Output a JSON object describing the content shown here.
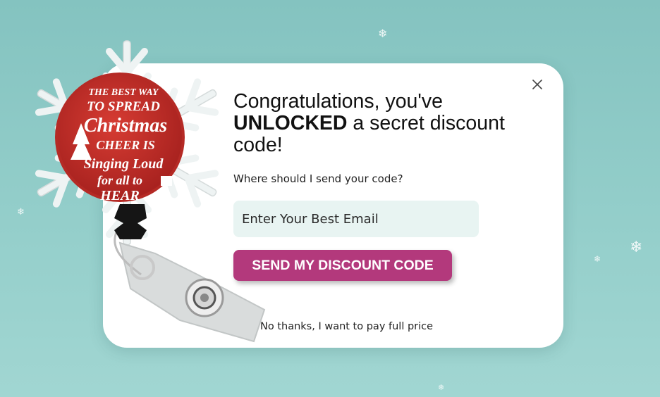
{
  "popup": {
    "headline_line1": "Congratulations, you've",
    "headline_bold": "UNLOCKED",
    "headline_rest": " a secret discount code!",
    "subtext": "Where should I send your code?",
    "email_placeholder": "Enter Your Best Email",
    "cta_label": "SEND MY DISCOUNT CODE",
    "decline_label": "No thanks, I want to pay full price"
  },
  "badge": {
    "lines": [
      "THE BEST WAY",
      "TO SPREAD",
      "Christmas",
      "CHEER IS",
      "Singing Loud",
      "for all to",
      "HEAR"
    ]
  },
  "icons": {
    "close": "close-icon",
    "snowflake": "snowflake-icon"
  },
  "colors": {
    "background": "#8cc8c4",
    "cta": "#b3397c",
    "input_bg": "#e8f4f2",
    "badge_red": "#c8302b"
  }
}
